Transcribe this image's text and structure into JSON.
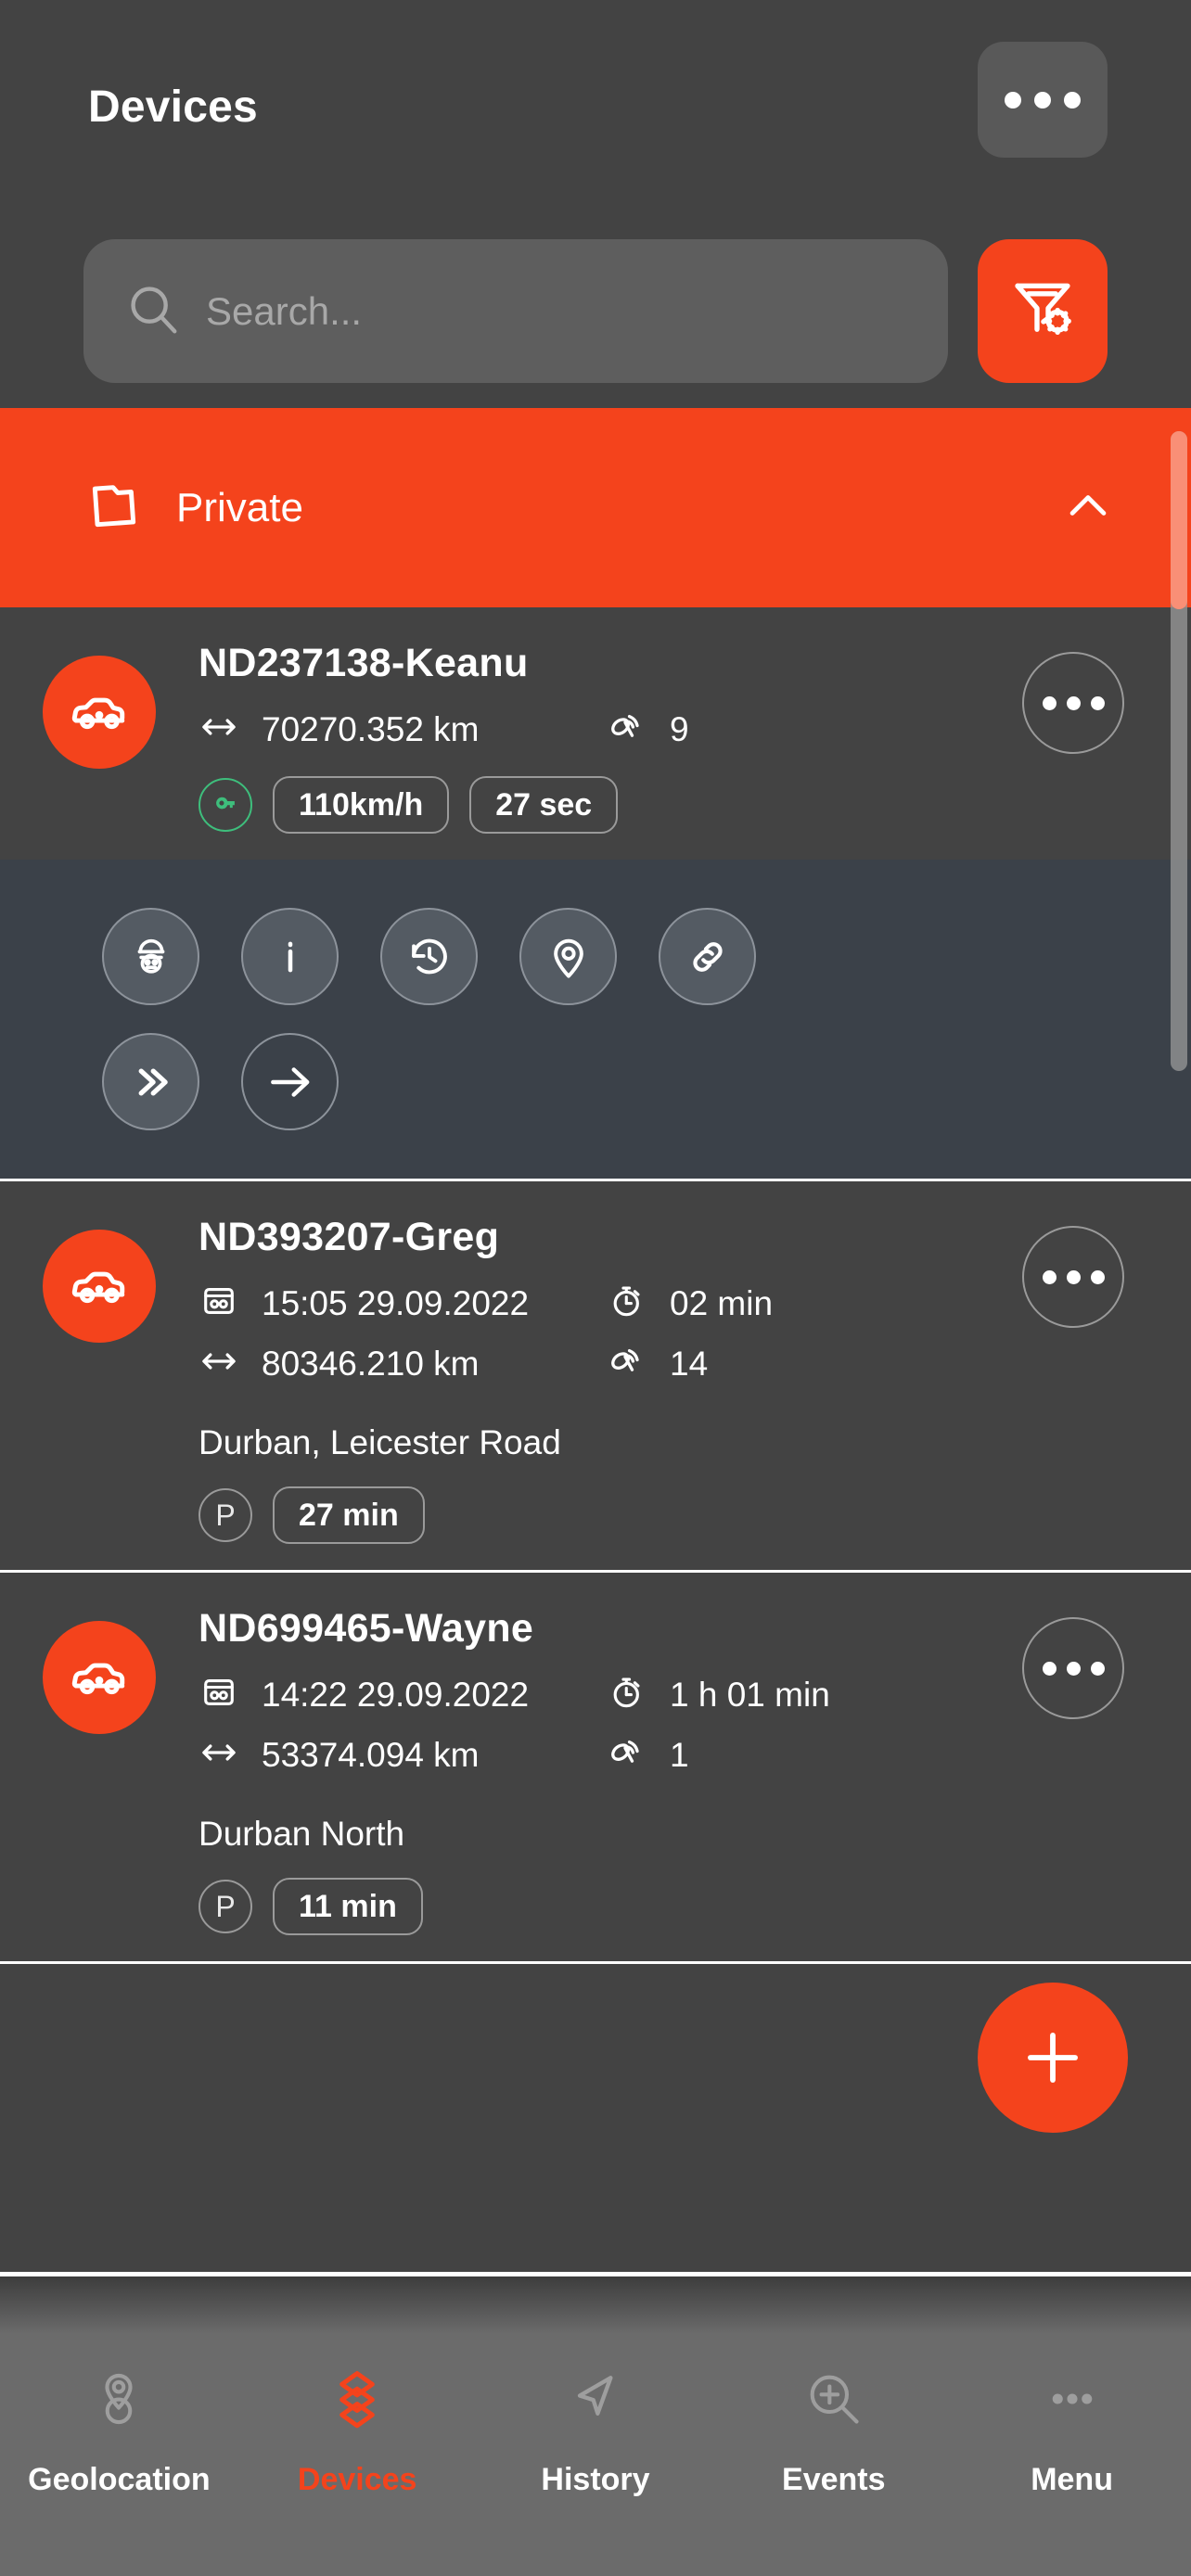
{
  "header": {
    "title": "Devices",
    "kebab_icon": "more-horizontal-icon",
    "search": {
      "placeholder": "Search...",
      "value": "",
      "icon": "search-icon"
    },
    "filter_button": {
      "icon": "filter-settings-icon",
      "color": "#f4431c"
    }
  },
  "folder": {
    "label": "Private",
    "icon": "folder-icon",
    "chevron": "chevron-up-icon",
    "expanded": true,
    "color": "#f4431c"
  },
  "devices": [
    {
      "name": "ND237138-Keanu",
      "avatar_icon": "car-icon",
      "avatar_color": "#f4431c",
      "expanded": true,
      "stats": [
        {
          "icon": "distance-icon",
          "value": "70270.352 km"
        },
        {
          "icon": "satellite-icon",
          "value": "9"
        }
      ],
      "badges": [
        {
          "type": "circle",
          "icon": "key-icon",
          "color": "#3ebe7c"
        },
        {
          "type": "pill",
          "label": "110km/h"
        },
        {
          "type": "pill",
          "label": "27 sec"
        }
      ],
      "actions": [
        {
          "icon": "driver-icon",
          "filled": true
        },
        {
          "icon": "info-icon",
          "filled": true
        },
        {
          "icon": "history-icon",
          "filled": true
        },
        {
          "icon": "location-pin-icon",
          "filled": true
        },
        {
          "icon": "link-icon",
          "filled": true
        },
        {
          "icon": "double-chevron-right-icon",
          "filled": true
        },
        {
          "icon": "arrow-right-icon",
          "filled": false
        }
      ],
      "kebab_icon": "more-horizontal-icon"
    },
    {
      "name": "ND393207-Greg",
      "avatar_icon": "car-icon",
      "avatar_color": "#f4431c",
      "expanded": false,
      "stats": [
        {
          "icon": "odometer-icon",
          "value": "15:05 29.09.2022"
        },
        {
          "icon": "stopwatch-icon",
          "value": "02 min"
        },
        {
          "icon": "distance-icon",
          "value": "80346.210 km"
        },
        {
          "icon": "satellite-icon",
          "value": "14"
        }
      ],
      "address": "Durban, Leicester Road",
      "badges": [
        {
          "type": "circle",
          "label": "P"
        },
        {
          "type": "pill",
          "label": "27 min"
        }
      ],
      "kebab_icon": "more-horizontal-icon"
    },
    {
      "name": "ND699465-Wayne",
      "avatar_icon": "car-icon",
      "avatar_color": "#f4431c",
      "expanded": false,
      "stats": [
        {
          "icon": "odometer-icon",
          "value": "14:22 29.09.2022"
        },
        {
          "icon": "stopwatch-icon",
          "value": "1 h 01 min"
        },
        {
          "icon": "distance-icon",
          "value": "53374.094 km"
        },
        {
          "icon": "satellite-icon",
          "value": "1"
        }
      ],
      "address": "Durban North",
      "badges": [
        {
          "type": "circle",
          "label": "P"
        },
        {
          "type": "pill",
          "label": "11 min"
        }
      ],
      "kebab_icon": "more-horizontal-icon"
    }
  ],
  "fab": {
    "icon": "plus-icon",
    "color": "#f4431c"
  },
  "bottom_nav": {
    "active_index": 1,
    "active_color": "#f4431c",
    "items": [
      {
        "label": "Geolocation",
        "icon": "map-pin-icon"
      },
      {
        "label": "Devices",
        "icon": "layers-icon"
      },
      {
        "label": "History",
        "icon": "navigation-arrow-icon"
      },
      {
        "label": "Events",
        "icon": "zoom-in-icon"
      },
      {
        "label": "Menu",
        "icon": "more-horizontal-icon"
      }
    ]
  }
}
